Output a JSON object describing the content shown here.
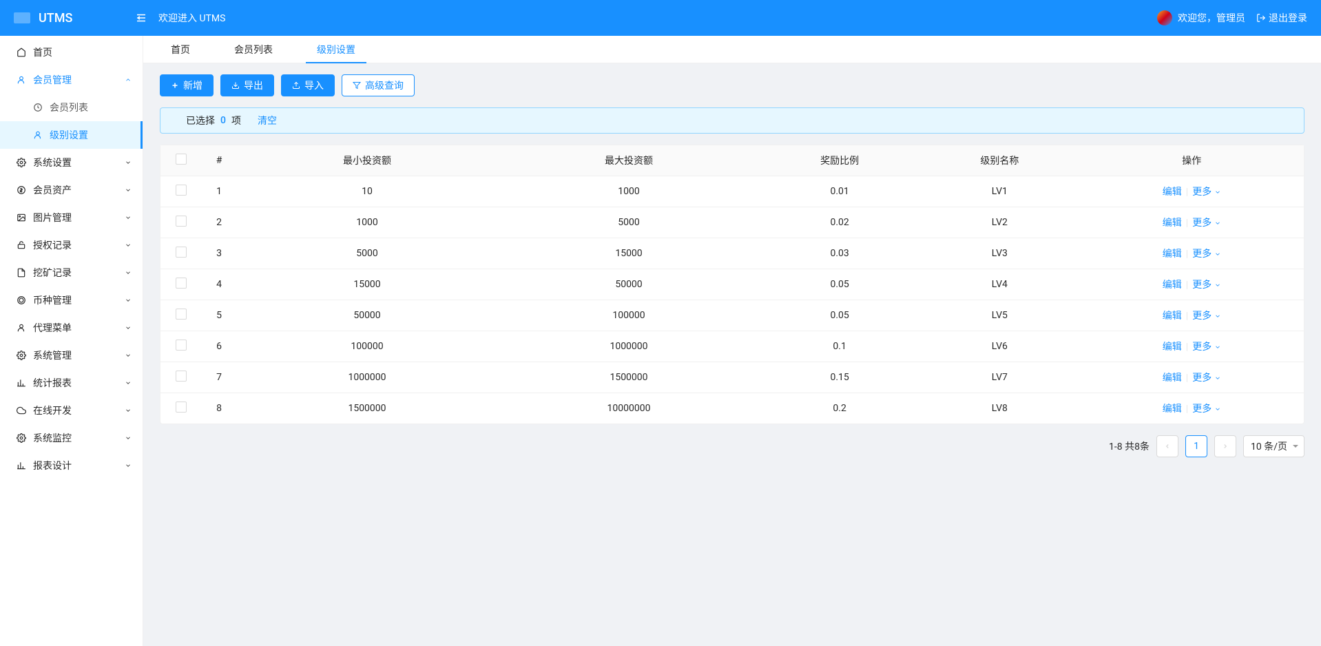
{
  "header": {
    "app_name": "UTMS",
    "welcome": "欢迎进入 UTMS",
    "user_greeting": "欢迎您，管理员",
    "logout": "退出登录"
  },
  "sidebar": {
    "items": [
      {
        "label": "首页",
        "icon": "home-icon"
      },
      {
        "label": "会员管理",
        "icon": "user-icon",
        "expanded": true,
        "children": [
          {
            "label": "会员列表",
            "icon": "clock-icon"
          },
          {
            "label": "级别设置",
            "icon": "user-icon",
            "active": true
          }
        ]
      },
      {
        "label": "系统设置",
        "icon": "gear-icon"
      },
      {
        "label": "会员资产",
        "icon": "dollar-icon"
      },
      {
        "label": "图片管理",
        "icon": "image-icon"
      },
      {
        "label": "授权记录",
        "icon": "unlock-icon"
      },
      {
        "label": "挖矿记录",
        "icon": "file-icon"
      },
      {
        "label": "币种管理",
        "icon": "coin-icon"
      },
      {
        "label": "代理菜单",
        "icon": "user-icon"
      },
      {
        "label": "系统管理",
        "icon": "gear-icon"
      },
      {
        "label": "统计报表",
        "icon": "chart-icon"
      },
      {
        "label": "在线开发",
        "icon": "cloud-icon"
      },
      {
        "label": "系统监控",
        "icon": "gear-icon"
      },
      {
        "label": "报表设计",
        "icon": "chart-icon"
      }
    ]
  },
  "tabs": [
    {
      "label": "首页"
    },
    {
      "label": "会员列表"
    },
    {
      "label": "级别设置",
      "active": true
    }
  ],
  "toolbar": {
    "add": "新增",
    "export": "导出",
    "import": "导入",
    "advanced_search": "高级查询"
  },
  "alert": {
    "prefix": "已选择",
    "count": "0",
    "suffix": "项",
    "clear": "清空"
  },
  "table": {
    "headers": {
      "num": "#",
      "min_invest": "最小投资额",
      "max_invest": "最大投资额",
      "reward_ratio": "奖励比例",
      "level_name": "级别名称",
      "action": "操作"
    },
    "action_edit": "编辑",
    "action_more": "更多",
    "rows": [
      {
        "num": "1",
        "min": "10",
        "max": "1000",
        "ratio": "0.01",
        "name": "LV1"
      },
      {
        "num": "2",
        "min": "1000",
        "max": "5000",
        "ratio": "0.02",
        "name": "LV2"
      },
      {
        "num": "3",
        "min": "5000",
        "max": "15000",
        "ratio": "0.03",
        "name": "LV3"
      },
      {
        "num": "4",
        "min": "15000",
        "max": "50000",
        "ratio": "0.05",
        "name": "LV4"
      },
      {
        "num": "5",
        "min": "50000",
        "max": "100000",
        "ratio": "0.05",
        "name": "LV5"
      },
      {
        "num": "6",
        "min": "100000",
        "max": "1000000",
        "ratio": "0.1",
        "name": "LV6"
      },
      {
        "num": "7",
        "min": "1000000",
        "max": "1500000",
        "ratio": "0.15",
        "name": "LV7"
      },
      {
        "num": "8",
        "min": "1500000",
        "max": "10000000",
        "ratio": "0.2",
        "name": "LV8"
      }
    ]
  },
  "pagination": {
    "summary": "1-8 共8条",
    "current": "1",
    "page_size": "10 条/页"
  }
}
